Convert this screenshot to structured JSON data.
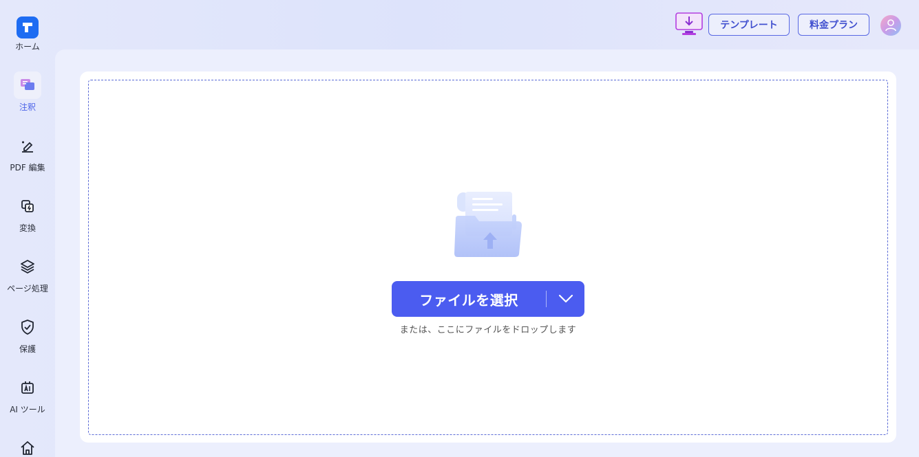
{
  "sidebar": {
    "items": [
      {
        "label": "ホーム",
        "icon": "home-logo-icon"
      },
      {
        "label": "注釈",
        "icon": "annotation-icon",
        "active": true
      },
      {
        "label": "PDF 編集",
        "icon": "edit-pen-icon"
      },
      {
        "label": "変換",
        "icon": "convert-icon"
      },
      {
        "label": "ページ処理",
        "icon": "layers-icon"
      },
      {
        "label": "保護",
        "icon": "shield-check-icon"
      },
      {
        "label": "AI ツール",
        "icon": "ai-tool-icon"
      },
      {
        "label": "",
        "icon": "house-icon"
      }
    ]
  },
  "header": {
    "download_icon": "download-monitor-icon",
    "template_label": "テンプレート",
    "pricing_label": "料金プラン",
    "avatar_icon": "user-avatar-icon"
  },
  "main": {
    "select_file_label": "ファイルを選択",
    "drop_hint": "または、ここにファイルをドロップします",
    "illustration_icon": "folder-upload-icon"
  },
  "colors": {
    "accent": "#4b5cf0",
    "active_label": "#4b63e8",
    "logo_blue": "#1e6cf2",
    "download_purple": "#b33ee0"
  }
}
